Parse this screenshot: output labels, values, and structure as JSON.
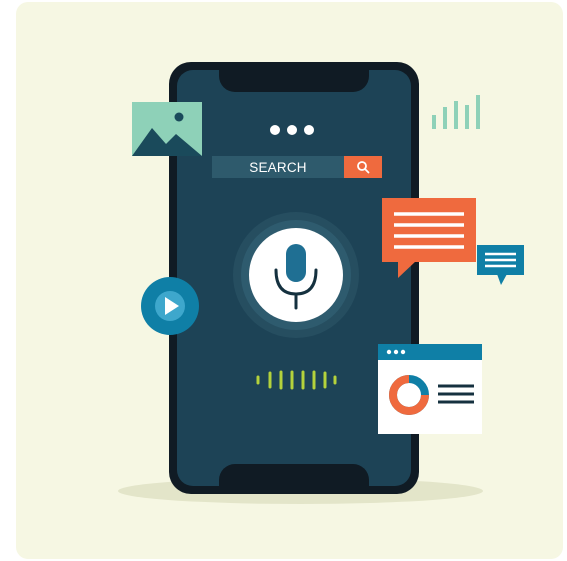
{
  "search": {
    "label": "SEARCH",
    "icon": "search-icon"
  },
  "colors": {
    "background": "#f6f7e3",
    "phone_body": "#101b24",
    "screen": "#1d4356",
    "accent_orange": "#ef6a3e",
    "accent_teal": "#0f7fa6",
    "accent_mint": "#8ed1b8",
    "sound_wave": "#b4d23c"
  },
  "icons": [
    "more-dots-icon",
    "search-icon",
    "microphone-icon",
    "sound-wave-icon",
    "image-icon",
    "play-icon",
    "chat-bubble-icon",
    "small-chat-bubble-icon",
    "bar-signal-icon",
    "donut-chart-icon"
  ]
}
